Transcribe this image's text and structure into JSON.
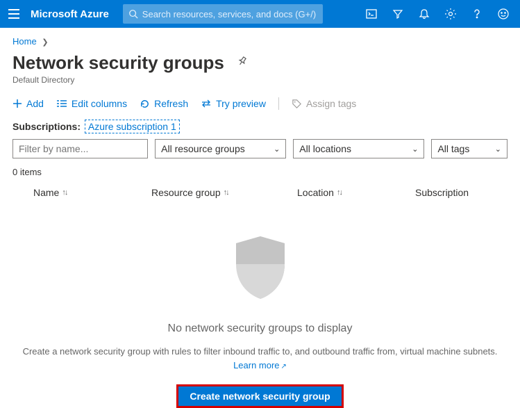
{
  "topbar": {
    "brand": "Microsoft Azure",
    "search_placeholder": "Search resources, services, and docs (G+/)"
  },
  "breadcrumb": {
    "home": "Home"
  },
  "page": {
    "title": "Network security groups",
    "subtitle": "Default Directory"
  },
  "toolbar": {
    "add": "Add",
    "edit_columns": "Edit columns",
    "refresh": "Refresh",
    "try_preview": "Try preview",
    "assign_tags": "Assign tags"
  },
  "subscriptions": {
    "label": "Subscriptions:",
    "link": "Azure subscription 1"
  },
  "filters": {
    "name_placeholder": "Filter by name...",
    "resource_groups": "All resource groups",
    "locations": "All locations",
    "tags": "All tags"
  },
  "list": {
    "count": "0 items",
    "columns": {
      "name": "Name",
      "resource_group": "Resource group",
      "location": "Location",
      "subscription": "Subscription"
    }
  },
  "empty": {
    "title": "No network security groups to display",
    "desc_prefix": "Create a network security group with rules to filter inbound traffic to, and outbound traffic from, virtual machine subnets. ",
    "learn_more": "Learn more",
    "cta": "Create network security group"
  }
}
